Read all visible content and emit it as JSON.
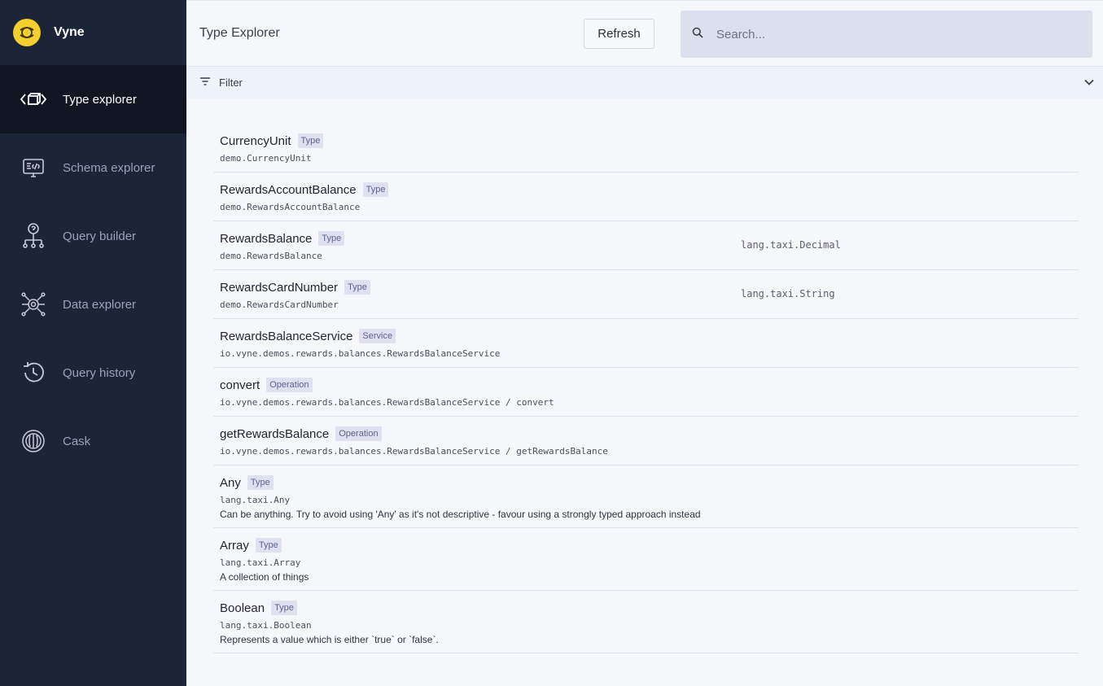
{
  "app": {
    "name": "Vyne",
    "accent": "#f4cf2d"
  },
  "sidebar": {
    "items": [
      {
        "label": "Type explorer",
        "icon": "type-explorer-icon",
        "active": true
      },
      {
        "label": "Schema explorer",
        "icon": "schema-explorer-icon"
      },
      {
        "label": "Query builder",
        "icon": "query-builder-icon"
      },
      {
        "label": "Data explorer",
        "icon": "data-explorer-icon"
      },
      {
        "label": "Query history",
        "icon": "query-history-icon"
      },
      {
        "label": "Cask",
        "icon": "cask-icon"
      }
    ]
  },
  "header": {
    "title": "Type Explorer",
    "refresh_label": "Refresh",
    "search_placeholder": "Search..."
  },
  "filter": {
    "label": "Filter"
  },
  "types": [
    {
      "name": "CurrencyUnit",
      "kind": "Type",
      "qualified": "demo.CurrencyUnit",
      "base": "",
      "description": ""
    },
    {
      "name": "RewardsAccountBalance",
      "kind": "Type",
      "qualified": "demo.RewardsAccountBalance",
      "base": "",
      "description": ""
    },
    {
      "name": "RewardsBalance",
      "kind": "Type",
      "qualified": "demo.RewardsBalance",
      "base": "lang.taxi.Decimal",
      "description": ""
    },
    {
      "name": "RewardsCardNumber",
      "kind": "Type",
      "qualified": "demo.RewardsCardNumber",
      "base": "lang.taxi.String",
      "description": ""
    },
    {
      "name": "RewardsBalanceService",
      "kind": "Service",
      "qualified": "io.vyne.demos.rewards.balances.RewardsBalanceService",
      "base": "",
      "description": ""
    },
    {
      "name": "convert",
      "kind": "Operation",
      "qualified": "io.vyne.demos.rewards.balances.RewardsBalanceService / convert",
      "base": "",
      "description": ""
    },
    {
      "name": "getRewardsBalance",
      "kind": "Operation",
      "qualified": "io.vyne.demos.rewards.balances.RewardsBalanceService / getRewardsBalance",
      "base": "",
      "description": ""
    },
    {
      "name": "Any",
      "kind": "Type",
      "qualified": "lang.taxi.Any",
      "base": "",
      "description": "Can be anything. Try to avoid using 'Any' as it's not descriptive - favour using a strongly typed approach instead"
    },
    {
      "name": "Array",
      "kind": "Type",
      "qualified": "lang.taxi.Array",
      "base": "",
      "description": "A collection of things"
    },
    {
      "name": "Boolean",
      "kind": "Type",
      "qualified": "lang.taxi.Boolean",
      "base": "",
      "description": "Represents a value which is either `true` or `false`."
    }
  ]
}
